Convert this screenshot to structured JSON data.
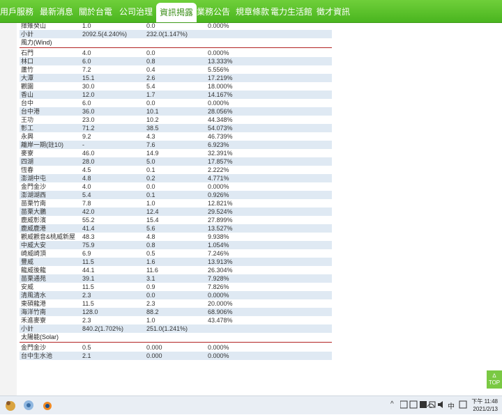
{
  "nav": {
    "items": [
      "用戶服務",
      "最新消息",
      "關於台電",
      "公司治理",
      "資訊揭露",
      "業務公告",
      "規章條款",
      "電力生活館",
      "徵才資訊"
    ],
    "active_index": 4
  },
  "rows_top": [
    {
      "name": "擇雉癸山",
      "cap": "1.0",
      "gen": "0.0",
      "pct": "0.000%"
    },
    {
      "name": "小計",
      "cap": "2092.5(4.240%)",
      "gen": "232.0(1.147%)",
      "pct": ""
    }
  ],
  "section_wind": "風力(Wind)",
  "rows_wind": [
    {
      "name": "石門",
      "cap": "4.0",
      "gen": "0.0",
      "pct": "0.000%"
    },
    {
      "name": "林口",
      "cap": "6.0",
      "gen": "0.8",
      "pct": "13.333%"
    },
    {
      "name": "蘆竹",
      "cap": "7.2",
      "gen": "0.4",
      "pct": "5.556%"
    },
    {
      "name": "大潭",
      "cap": "15.1",
      "gen": "2.6",
      "pct": "17.219%"
    },
    {
      "name": "觀園",
      "cap": "30.0",
      "gen": "5.4",
      "pct": "18.000%"
    },
    {
      "name": "香山",
      "cap": "12.0",
      "gen": "1.7",
      "pct": "14.167%"
    },
    {
      "name": "台中",
      "cap": "6.0",
      "gen": "0.0",
      "pct": "0.000%"
    },
    {
      "name": "台中港",
      "cap": "36.0",
      "gen": "10.1",
      "pct": "28.056%"
    },
    {
      "name": "王功",
      "cap": "23.0",
      "gen": "10.2",
      "pct": "44.348%"
    },
    {
      "name": "彰工",
      "cap": "71.2",
      "gen": "38.5",
      "pct": "54.073%"
    },
    {
      "name": "永興",
      "cap": "9.2",
      "gen": "4.3",
      "pct": "46.739%"
    },
    {
      "name": "離岸一期(註10)",
      "cap": "-",
      "gen": "7.6",
      "pct": "6.923%"
    },
    {
      "name": "麥寮",
      "cap": "46.0",
      "gen": "14.9",
      "pct": "32.391%"
    },
    {
      "name": "四湖",
      "cap": "28.0",
      "gen": "5.0",
      "pct": "17.857%"
    },
    {
      "name": "恆春",
      "cap": "4.5",
      "gen": "0.1",
      "pct": "2.222%"
    },
    {
      "name": "澎湖中屯",
      "cap": "4.8",
      "gen": "0.2",
      "pct": "4.771%"
    },
    {
      "name": "金門金沙",
      "cap": "4.0",
      "gen": "0.0",
      "pct": "0.000%"
    },
    {
      "name": "澎湖湖西",
      "cap": "5.4",
      "gen": "0.1",
      "pct": "0.926%"
    },
    {
      "name": "苗栗竹南",
      "cap": "7.8",
      "gen": "1.0",
      "pct": "12.821%"
    },
    {
      "name": "苗栗大鵬",
      "cap": "42.0",
      "gen": "12.4",
      "pct": "29.524%"
    },
    {
      "name": "鹿威彰濱",
      "cap": "55.2",
      "gen": "15.4",
      "pct": "27.899%"
    },
    {
      "name": "鹿威鹿港",
      "cap": "41.4",
      "gen": "5.6",
      "pct": "13.527%"
    },
    {
      "name": "觀威觀音&桃威新屋",
      "cap": "48.3",
      "gen": "4.8",
      "pct": "9.938%"
    },
    {
      "name": "中威大安",
      "cap": "75.9",
      "gen": "0.8",
      "pct": "1.054%"
    },
    {
      "name": "崎威崎頂",
      "cap": "6.9",
      "gen": "0.5",
      "pct": "7.246%"
    },
    {
      "name": "豐威",
      "cap": "11.5",
      "gen": "1.6",
      "pct": "13.913%"
    },
    {
      "name": "龍威後龍",
      "cap": "44.1",
      "gen": "11.6",
      "pct": "26.304%"
    },
    {
      "name": "苗栗通苑",
      "cap": "39.1",
      "gen": "3.1",
      "pct": "7.928%"
    },
    {
      "name": "安威",
      "cap": "11.5",
      "gen": "0.9",
      "pct": "7.826%"
    },
    {
      "name": "清風清水",
      "cap": "2.3",
      "gen": "0.0",
      "pct": "0.000%"
    },
    {
      "name": "東碩龍港",
      "cap": "11.5",
      "gen": "2.3",
      "pct": "20.000%"
    },
    {
      "name": "海洋竹南",
      "cap": "128.0",
      "gen": "88.2",
      "pct": "68.906%"
    },
    {
      "name": "禾進麥寮",
      "cap": "2.3",
      "gen": "1.0",
      "pct": "43.478%"
    },
    {
      "name": "小計",
      "cap": "840.2(1.702%)",
      "gen": "251.0(1.241%)",
      "pct": ""
    }
  ],
  "section_solar": "太陽能(Solar)",
  "rows_solar": [
    {
      "name": "金門金沙",
      "cap": "0.5",
      "gen": "0.000",
      "pct": "0.000%"
    },
    {
      "name": "台中生水池",
      "cap": "2.1",
      "gen": "0.000",
      "pct": "0.000%"
    }
  ],
  "top_button": {
    "arrow": "∆",
    "label": "TOP"
  },
  "taskbar": {
    "ime": "中",
    "time": "下午 11:48",
    "date": "2021/2/13"
  }
}
